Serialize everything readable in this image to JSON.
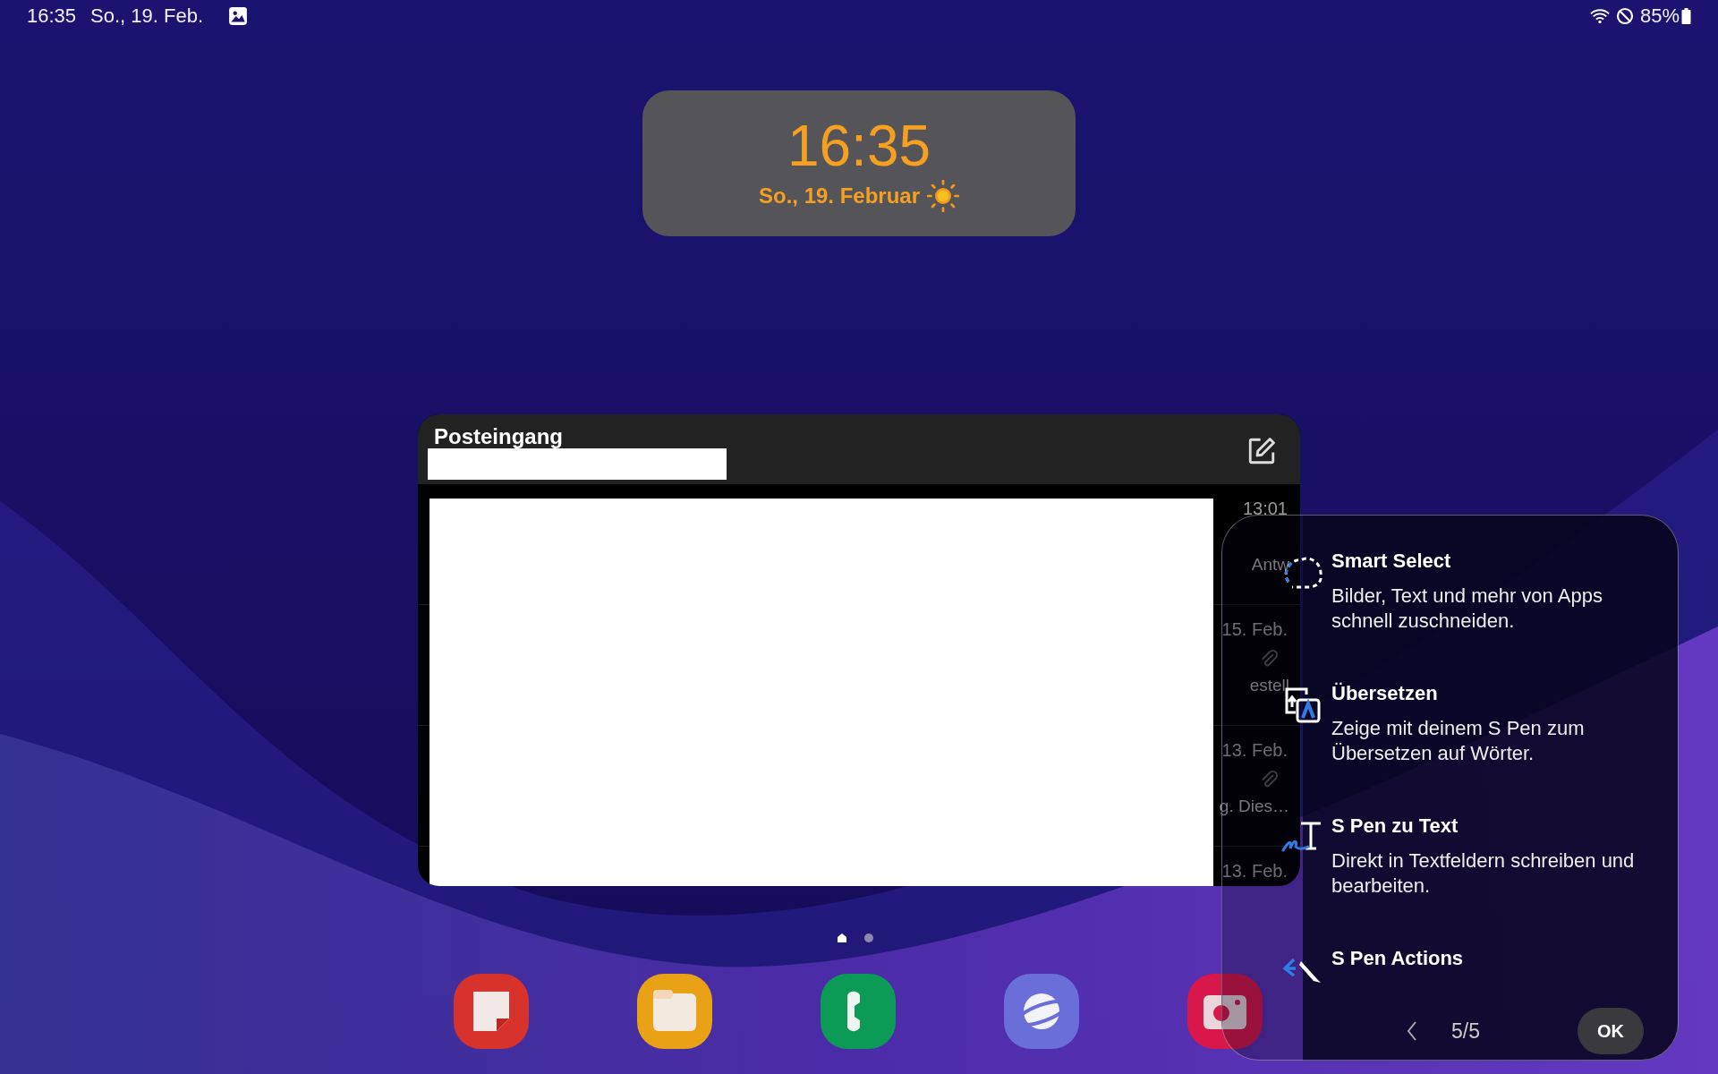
{
  "status_bar": {
    "time": "16:35",
    "date": "So., 19. Feb.",
    "battery": "85%"
  },
  "clock_widget": {
    "time": "16:35",
    "date": "So., 19. Februar"
  },
  "mail_widget": {
    "title": "Posteingang",
    "rows": [
      {
        "date": "13:01",
        "attachment": false,
        "snippet": "Antw"
      },
      {
        "date": "15. Feb.",
        "attachment": true,
        "snippet": "estell"
      },
      {
        "date": "13. Feb.",
        "attachment": true,
        "snippet": "g. Dies…"
      },
      {
        "date": "13. Feb.",
        "attachment": false
      }
    ]
  },
  "page_indicator": [
    {
      "selected": true
    },
    {
      "selected": false
    }
  ],
  "tips_panel": {
    "items": [
      {
        "title": "Smart Select",
        "description": "Bilder, Text und mehr von Apps schnell zuschneiden."
      },
      {
        "title": "Übersetzen",
        "description": "Zeige mit deinem S Pen zum Übersetzen auf Wörter."
      },
      {
        "title": "S Pen zu Text",
        "description": "Direkt in Textfeldern schreiben und bearbeiten."
      },
      {
        "title": "S Pen Actions"
      }
    ],
    "page": "5/5",
    "ok_button": "OK"
  }
}
